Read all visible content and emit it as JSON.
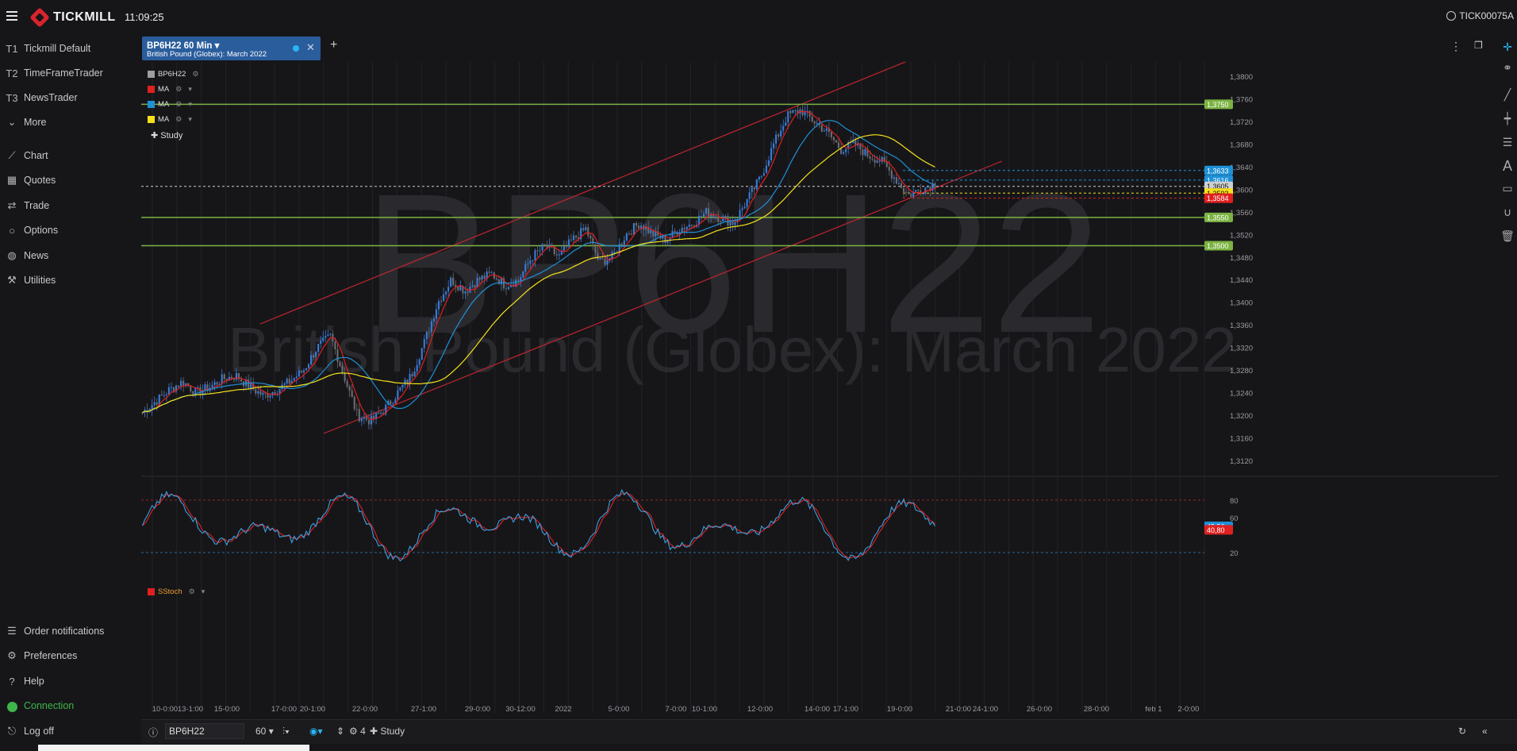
{
  "app": {
    "logo": "TICKMILL",
    "clock": "11:09:25",
    "account": "TICK00075A"
  },
  "sidebar": {
    "templates": [
      {
        "key": "T1",
        "label": "Tickmill Default"
      },
      {
        "key": "T2",
        "label": "TimeFrameTrader"
      },
      {
        "key": "T3",
        "label": "NewsTrader"
      }
    ],
    "more": "More",
    "nav": [
      {
        "label": "Chart",
        "icon": "chart-line-icon"
      },
      {
        "label": "Quotes",
        "icon": "grid-icon"
      },
      {
        "label": "Trade",
        "icon": "arrows-icon"
      },
      {
        "label": "Options",
        "icon": "circle-icon"
      },
      {
        "label": "News",
        "icon": "globe-icon"
      },
      {
        "label": "Utilities",
        "icon": "wrench-icon"
      }
    ],
    "bottom": [
      {
        "label": "Order notifications",
        "icon": "list-icon"
      },
      {
        "label": "Preferences",
        "icon": "gears-icon"
      },
      {
        "label": "Help",
        "icon": "question-icon"
      },
      {
        "label": "Connection",
        "icon": "status-dot-icon",
        "color": "#3fb54a"
      },
      {
        "label": "Log off",
        "icon": "logout-icon"
      }
    ]
  },
  "tab": {
    "title": "BP6H22 60 Min",
    "subtitle": "British Pound (Globex): March 2022"
  },
  "legend": {
    "items": [
      {
        "label": "BP6H22",
        "color": "#9e9e9e"
      },
      {
        "label": "MA",
        "color": "#e02020"
      },
      {
        "label": "MA",
        "color": "#1e90d6"
      },
      {
        "label": "MA",
        "color": "#f5e11a"
      }
    ],
    "study": "Study",
    "oscillator": {
      "label": "SStoch",
      "color": "#e02020"
    }
  },
  "watermark": {
    "symbol": "BP6H22",
    "name": "British Pound (Globex): March 2022"
  },
  "chart_data": {
    "type": "candlestick",
    "symbol": "BP6H22",
    "interval": "60 Min",
    "y_ticks": [
      "1,3800",
      "1,3760",
      "1,3720",
      "1,3680",
      "1,3640",
      "1,3600",
      "1,3560",
      "1,3520",
      "1,3480",
      "1,3440",
      "1,3400",
      "1,3360",
      "1,3320",
      "1,3280",
      "1,3240",
      "1,3200",
      "1,3160",
      "1,3120"
    ],
    "ylim": [
      1.3095,
      1.3825
    ],
    "x_labels": [
      "10-0:00",
      "13-1:00",
      "15-0:00",
      "17-0:00",
      "20-1:00",
      "22-0:00",
      "27-1:00",
      "29-0:00",
      "30-12:00",
      "2022",
      "5-0:00",
      "7-0:00",
      "10-1:00",
      "12-0:00",
      "14-0:00",
      "17-1:00",
      "19-0:00",
      "21-0:00",
      "24-1:00",
      "26-0:00",
      "28-0:00",
      "feb 1",
      "2-0:00"
    ],
    "horizontal_levels": [
      {
        "label": "1,3750",
        "value": 1.375,
        "color": "#7cb342"
      },
      {
        "label": "1,3550",
        "value": 1.355,
        "color": "#7cb342"
      },
      {
        "label": "1,3500",
        "value": 1.35,
        "color": "#7cb342"
      }
    ],
    "price_tags": [
      {
        "label": "1,3633",
        "value": 1.3633,
        "color": "#1e90d6"
      },
      {
        "label": "1,3616",
        "value": 1.3616,
        "color": "#1e90d6"
      },
      {
        "label": "1,3605",
        "value": 1.3605,
        "color": "#cfcfcf"
      },
      {
        "label": "1,3593",
        "value": 1.3593,
        "color": "#f5e11a"
      },
      {
        "label": "1,3584",
        "value": 1.3584,
        "color": "#e02020"
      }
    ],
    "close_approx": [
      1.3205,
      1.3225,
      1.3245,
      1.326,
      1.324,
      1.325,
      1.3265,
      1.327,
      1.325,
      1.3235,
      1.3245,
      1.326,
      1.328,
      1.332,
      1.334,
      1.327,
      1.32,
      1.319,
      1.321,
      1.324,
      1.327,
      1.333,
      1.34,
      1.344,
      1.342,
      1.344,
      1.345,
      1.343,
      1.344,
      1.348,
      1.35,
      1.348,
      1.351,
      1.353,
      1.347,
      1.348,
      1.352,
      1.354,
      1.352,
      1.351,
      1.353,
      1.354,
      1.356,
      1.355,
      1.354,
      1.358,
      1.362,
      1.368,
      1.373,
      1.374,
      1.372,
      1.37,
      1.367,
      1.368,
      1.366,
      1.365,
      1.362,
      1.359,
      1.36,
      1.361
    ],
    "oscillator": {
      "name": "SStoch",
      "y_ticks": [
        "80",
        "60",
        "20"
      ],
      "levels": [
        80,
        20
      ],
      "tags": [
        {
          "label": "45,56",
          "color": "#1e90d6"
        },
        {
          "label": "40,80",
          "color": "#e02020"
        }
      ]
    }
  },
  "toolbar_bottom": {
    "symbol": "BP6H22",
    "interval": "60",
    "studies_count": "4",
    "study_label": "Study"
  }
}
